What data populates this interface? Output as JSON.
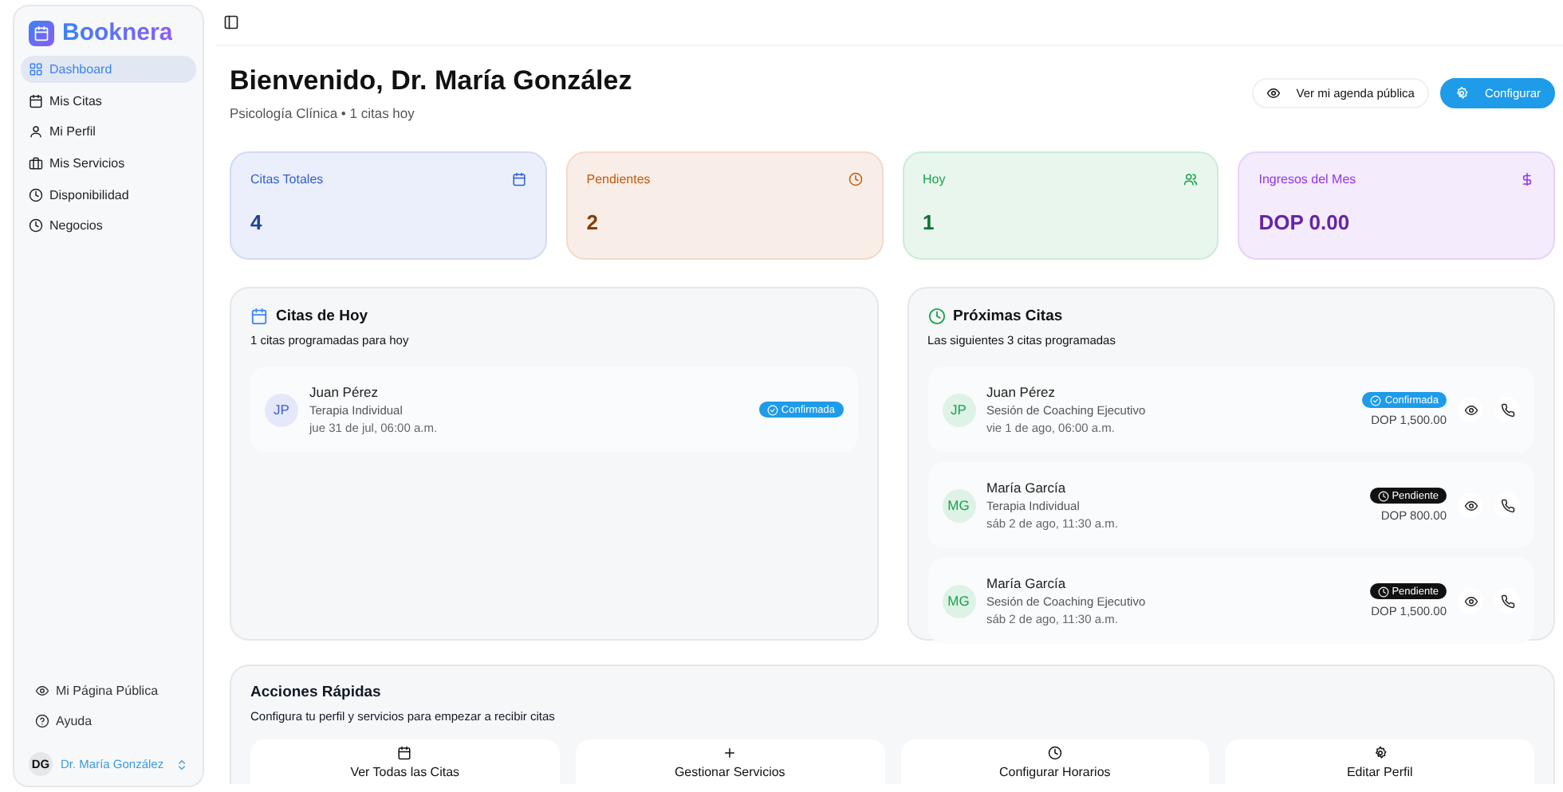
{
  "sidebar": {
    "logo": "Booknera",
    "items": [
      {
        "label": "Dashboard",
        "selected": true
      },
      {
        "label": "Mis Citas",
        "selected": false
      },
      {
        "label": "Mi Perfil",
        "selected": false
      },
      {
        "label": "Mis Servicios",
        "selected": false
      },
      {
        "label": "Disponibilidad",
        "selected": false
      },
      {
        "label": "Negocios",
        "selected": false
      }
    ],
    "footer_items": [
      "Mi Página Pública",
      "Ayuda"
    ],
    "user": {
      "initials": "DG",
      "name": "Dr. María González"
    }
  },
  "header": {
    "title": "Bienvenido, Dr. María González",
    "subtitle": "Psicología Clínica • 1 citas hoy",
    "buttons": [
      {
        "label": "Ver mi agenda pública",
        "kind": "outline"
      },
      {
        "label": "Configurar",
        "kind": "primary"
      }
    ]
  },
  "stats": [
    {
      "label": "Citas Totales",
      "value": "4",
      "color": "#2f5bd3"
    },
    {
      "label": "Pendientes",
      "value": "2",
      "color": "#c2570c"
    },
    {
      "label": "Hoy",
      "value": "1",
      "color": "#16a34a"
    },
    {
      "label": "Ingresos del Mes",
      "value": "DOP 0.00",
      "color": "#9333ea"
    }
  ],
  "today": {
    "title": "Citas de Hoy",
    "subtitle": "1 citas programadas para hoy",
    "appointments": [
      {
        "initials": "JP",
        "name": "Juan Pérez",
        "service": "Terapia Individual",
        "datetime": "jue 31 de jul, 06:00 a.m.",
        "status": "Confirmada",
        "kind": "confirmed",
        "color": "#3b5bdb"
      }
    ]
  },
  "upcoming": {
    "title": "Próximas Citas",
    "subtitle": "Las siguientes 3 citas programadas",
    "appointments": [
      {
        "initials": "JP",
        "name": "Juan Pérez",
        "service": "Sesión de Coaching Ejecutivo",
        "datetime": "vie 1 de ago, 06:00 a.m.",
        "status": "Confirmada",
        "kind": "confirmed",
        "price": "DOP 1,500.00",
        "color": "#16a34a"
      },
      {
        "initials": "MG",
        "name": "María García",
        "service": "Terapia Individual",
        "datetime": "sáb 2 de ago, 11:30 a.m.",
        "status": "Pendiente",
        "kind": "pending",
        "price": "DOP 800.00",
        "color": "#16a34a"
      },
      {
        "initials": "MG",
        "name": "María García",
        "service": "Sesión de Coaching Ejecutivo",
        "datetime": "sáb 2 de ago, 11:30 a.m.",
        "status": "Pendiente",
        "kind": "pending",
        "price": "DOP 1,500.00",
        "color": "#16a34a"
      }
    ]
  },
  "quick_actions": {
    "title": "Acciones Rápidas",
    "subtitle": "Configura tu perfil y servicios para empezar a recibir citas",
    "actions": [
      "Ver Todas las Citas",
      "Gestionar Servicios",
      "Configurar Horarios",
      "Editar Perfil"
    ]
  }
}
